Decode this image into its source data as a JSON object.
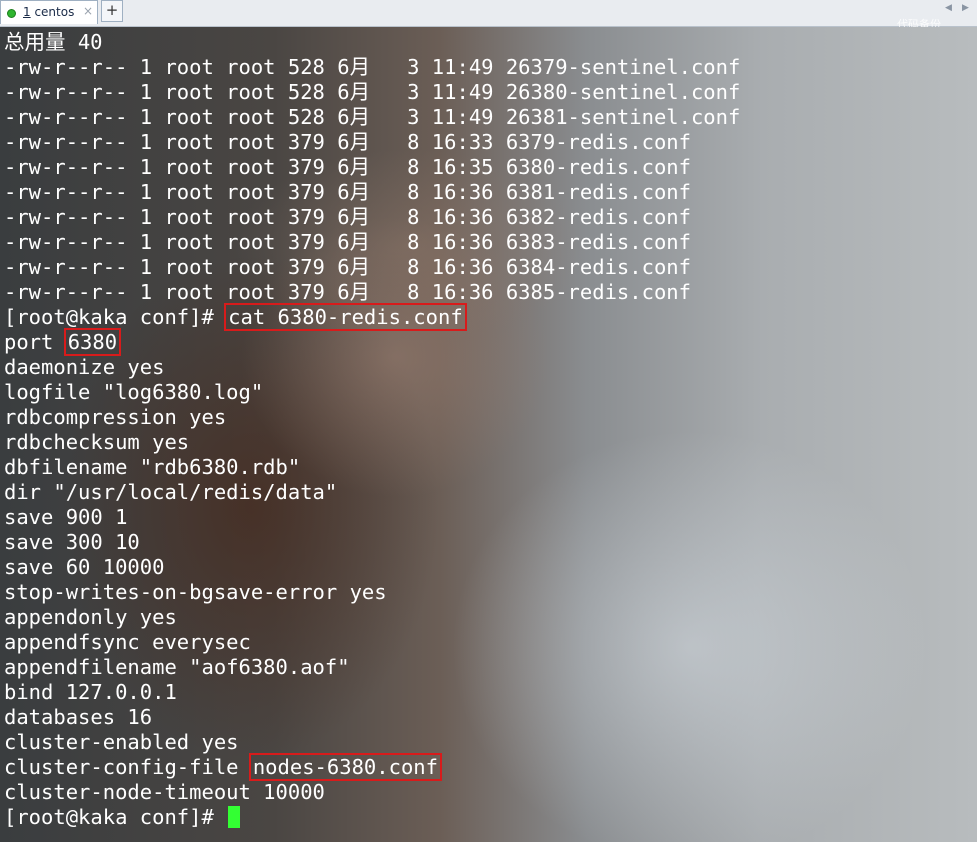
{
  "tabbar": {
    "tab": {
      "number": "1",
      "label": " centos",
      "close": "×"
    },
    "add": "+",
    "nav_left": "◀",
    "nav_right": "▶",
    "corner_text": "代码备份"
  },
  "terminal": {
    "lines": [
      "总用量 40",
      "-rw-r--r-- 1 root root 528 6月   3 11:49 26379-sentinel.conf",
      "-rw-r--r-- 1 root root 528 6月   3 11:49 26380-sentinel.conf",
      "-rw-r--r-- 1 root root 528 6月   3 11:49 26381-sentinel.conf",
      "-rw-r--r-- 1 root root 379 6月   8 16:33 6379-redis.conf",
      "-rw-r--r-- 1 root root 379 6月   8 16:35 6380-redis.conf",
      "-rw-r--r-- 1 root root 379 6月   8 16:36 6381-redis.conf",
      "-rw-r--r-- 1 root root 379 6月   8 16:36 6382-redis.conf",
      "-rw-r--r-- 1 root root 379 6月   8 16:36 6383-redis.conf",
      "-rw-r--r-- 1 root root 379 6月   8 16:36 6384-redis.conf",
      "-rw-r--r-- 1 root root 379 6月   8 16:36 6385-redis.conf"
    ],
    "cmd_prompt": "[root@kaka conf]# ",
    "cmd_text": "cat 6380-redis.conf",
    "port_key": "port ",
    "port_value": "6380",
    "config_lines": [
      "daemonize yes",
      "logfile \"log6380.log\"",
      "rdbcompression yes",
      "rdbchecksum yes",
      "dbfilename \"rdb6380.rdb\"",
      "dir \"/usr/local/redis/data\"",
      "save 900 1",
      "save 300 10",
      "save 60 10000",
      "stop-writes-on-bgsave-error yes",
      "appendonly yes",
      "appendfsync everysec",
      "appendfilename \"aof6380.aof\"",
      "bind 127.0.0.1",
      "databases 16",
      "cluster-enabled yes"
    ],
    "cluster_file_key": "cluster-config-file ",
    "cluster_file_value": "nodes-6380.conf",
    "timeout_line": "cluster-node-timeout 10000",
    "final_prompt": "[root@kaka conf]# "
  },
  "colors": {
    "text": "#ffffff",
    "highlight_box": "#d81b1b",
    "cursor": "#33ff33"
  }
}
